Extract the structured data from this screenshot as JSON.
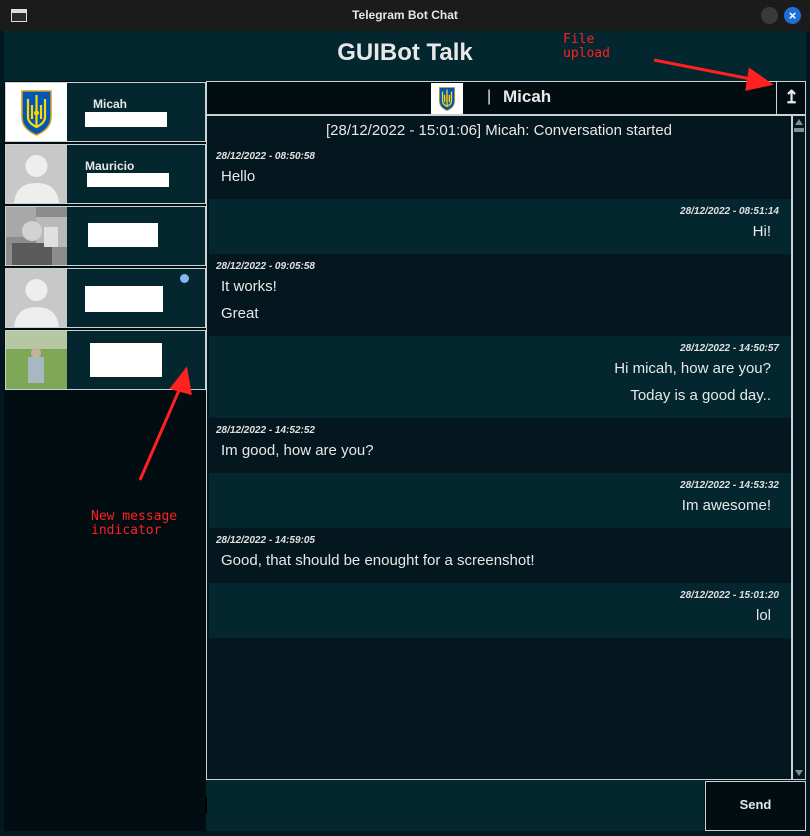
{
  "window": {
    "title": "Telegram Bot Chat"
  },
  "app": {
    "title": "GUIBot Talk"
  },
  "contacts": [
    {
      "name": "Micah",
      "avatar": "ukraine-coat-of-arms"
    },
    {
      "name": "Mauricio",
      "avatar": "default-person-icon"
    },
    {
      "name": "",
      "avatar": "photo"
    },
    {
      "name": "",
      "avatar": "default-person-icon"
    },
    {
      "name": "",
      "avatar": "photo-field",
      "unread": true
    }
  ],
  "chat": {
    "peer_name": "Micah",
    "separator": "|",
    "upload_icon": "↥",
    "system_line": "[28/12/2022 - 15:01:06] Micah: Conversation started",
    "messages": [
      {
        "dir": "in",
        "time": "28/12/2022 - 08:50:58",
        "lines": [
          "Hello"
        ]
      },
      {
        "dir": "out",
        "time": "28/12/2022 - 08:51:14",
        "lines": [
          "Hi!"
        ]
      },
      {
        "dir": "in",
        "time": "28/12/2022 - 09:05:58",
        "lines": [
          "It works!",
          "Great"
        ]
      },
      {
        "dir": "out",
        "time": "28/12/2022 - 14:50:57",
        "lines": [
          "Hi micah, how are you?",
          "Today is a good day.."
        ]
      },
      {
        "dir": "in",
        "time": "28/12/2022 - 14:52:52",
        "lines": [
          "Im good, how are you?"
        ]
      },
      {
        "dir": "out",
        "time": "28/12/2022 - 14:53:32",
        "lines": [
          "Im awesome!"
        ]
      },
      {
        "dir": "in",
        "time": "28/12/2022 - 14:59:05",
        "lines": [
          "Good, that should be enought for a screenshot!"
        ]
      },
      {
        "dir": "out",
        "time": "28/12/2022 - 15:01:20",
        "lines": [
          "lol"
        ]
      }
    ]
  },
  "composer": {
    "value": "",
    "send_label": "Send"
  },
  "annotations": {
    "file_upload": "File\nupload",
    "new_message": "New message\nindicator"
  },
  "colors": {
    "header_bg": "#03262f",
    "panel_bg": "#04161e",
    "annotation_red": "#ff2020",
    "unread_dot": "#82b9ee"
  }
}
